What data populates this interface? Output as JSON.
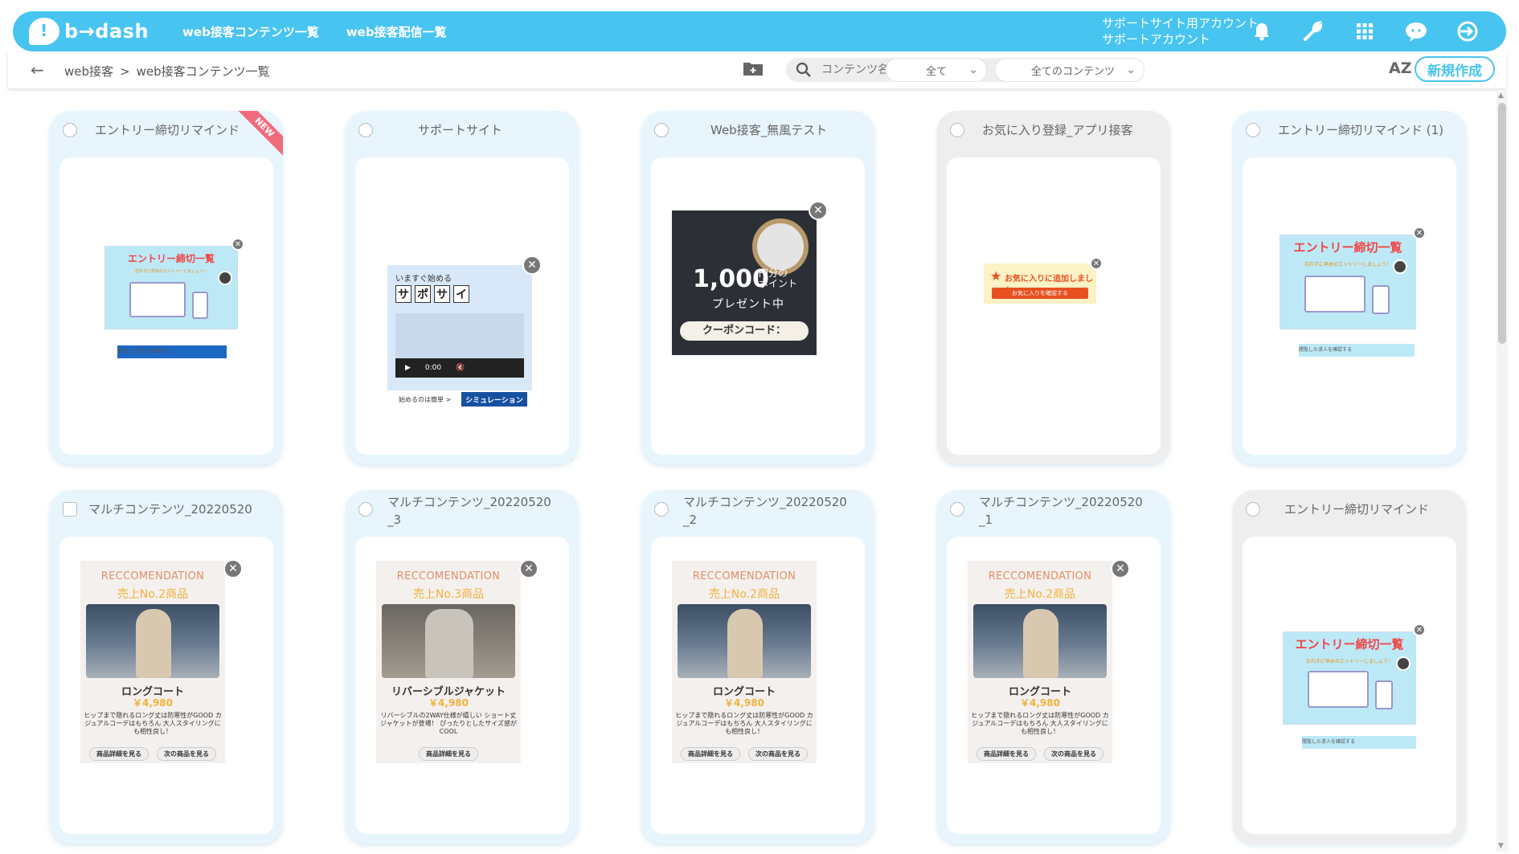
{
  "header": {
    "logo": "b→dash",
    "nav": [
      "web接客コンテンツ一覧",
      "web接客配信一覧"
    ],
    "account_line1": "サポートサイト用アカウント",
    "account_line2": "サポートアカウント"
  },
  "subbar": {
    "breadcrumb_root": "web接客",
    "breadcrumb_sep": ">",
    "breadcrumb_current": "web接客コンテンツ一覧",
    "search_placeholder": "コンテンツ名で検索",
    "filter1": "全て",
    "filter2": "全てのコンテンツ",
    "sort_label": "AZ",
    "new_button": "新規作成"
  },
  "colors": {
    "accent": "#48c4f0",
    "selected_dash": "#f26b7c",
    "card_bg": "#e8f5fd",
    "card_gray": "#eeeeee"
  },
  "cards": [
    {
      "title": "エントリー締切リマインド",
      "badge": "NEW"
    },
    {
      "title": "サポートサイト"
    },
    {
      "title": "Web接客_無風テスト"
    },
    {
      "title": "お気に入り登録_アプリ接客"
    },
    {
      "title": "エントリー締切リマインド (1)"
    },
    {
      "title": "マルチコンテンツ_20220520"
    },
    {
      "title": "マルチコンテンツ_20220520",
      "title2": "_3"
    },
    {
      "title": "マルチコンテンツ_20220520",
      "title2": "_2"
    },
    {
      "title": "マルチコンテンツ_20220520",
      "title2": "_1"
    },
    {
      "title": "エントリー締切リマインド"
    }
  ],
  "entry_banner": {
    "title": "エントリー締切一覧",
    "sub": "忘れずに早めのエントリーしましょう！",
    "button": "閲覧した求人を確認する"
  },
  "support_banner": {
    "top": "いますぐ始める",
    "chars": [
      "サ",
      "ポ",
      "サ",
      "イ"
    ],
    "time": "0:00",
    "foot_left": "始めるのは簡単 >",
    "foot_right": "シミュレーション"
  },
  "coupon_banner": {
    "big": "1,000",
    "small1": "円分の",
    "small2": "ポイント",
    "present": "プレゼント中",
    "code": "クーポンコード："
  },
  "fav_banner": {
    "text": "お気に入りに追加しました",
    "button": "お気に入りを確認する"
  },
  "rec_banners": [
    {
      "h1": "RECCOMENDATION",
      "h2": "売上No.2商品",
      "name": "ロングコート",
      "price": "￥4,980",
      "desc": "ヒップまで隠れるロング丈は防寒性がGOOD カジュアルコーデはもちろん 大人スタイリングにも相性良し！",
      "b1": "商品詳細を見る",
      "b2": "次の商品を見る"
    },
    {
      "h1": "RECCOMENDATION",
      "h2": "売上No.3商品",
      "name": "リバーシブルジャケット",
      "price": "￥4,980",
      "desc": "リバーシブルの2WAY仕様が嬉しい ショート丈ジャケットが登場！ ぴったりとしたサイズ感がCOOL",
      "b1": "商品詳細を見る"
    },
    {
      "h1": "RECCOMENDATION",
      "h2": "売上No.2商品",
      "name": "ロングコート",
      "price": "￥4,980",
      "desc": "ヒップまで隠れるロング丈は防寒性がGOOD カジュアルコーデはもちろん 大人スタイリングにも相性良し！",
      "b1": "商品詳細を見る",
      "b2": "次の商品を見る"
    },
    {
      "h1": "RECCOMENDATION",
      "h2": "売上No.2商品",
      "name": "ロングコート",
      "price": "￥4,980",
      "desc": "ヒップまで隠れるロング丈は防寒性がGOOD カジュアルコーデはもちろん 大人スタイリングにも相性良し！",
      "b1": "商品詳細を見る",
      "b2": "次の商品を見る"
    }
  ]
}
